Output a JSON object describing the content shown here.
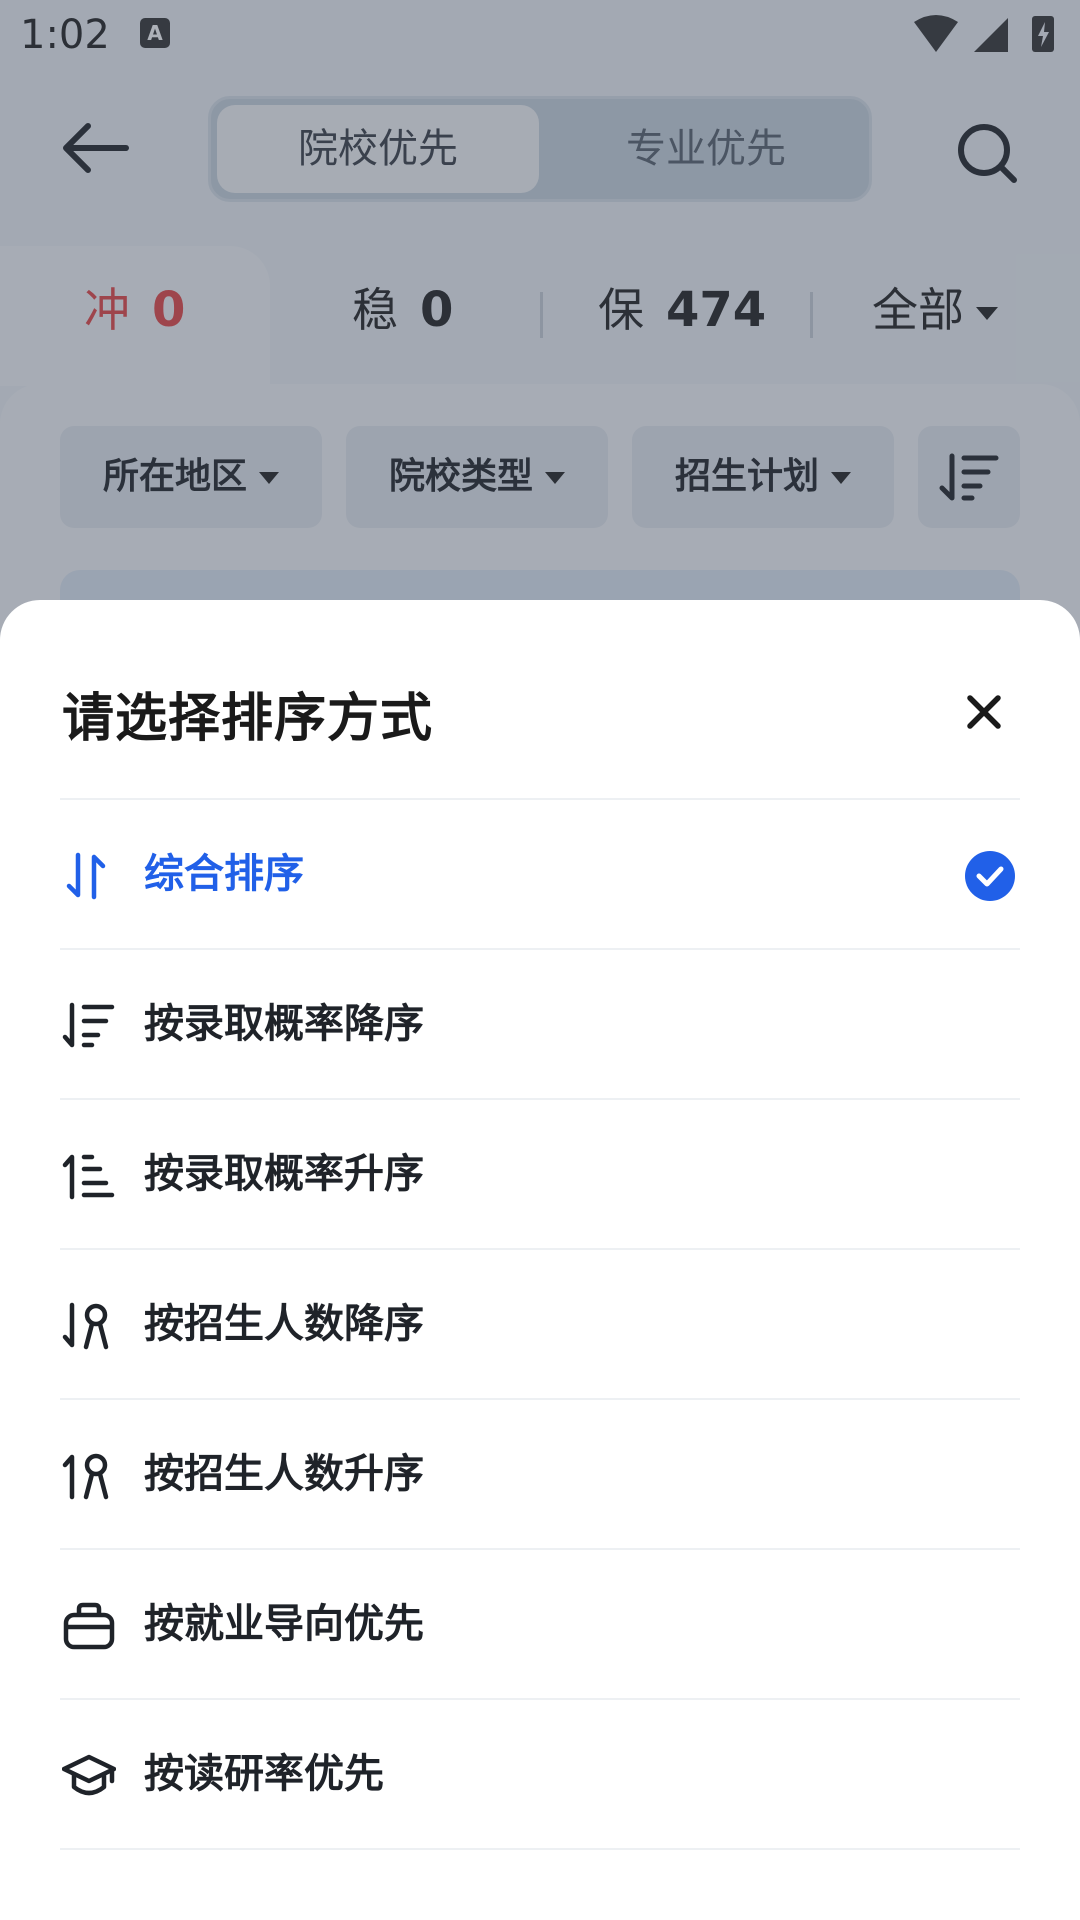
{
  "status_bar": {
    "time": "1:02",
    "notif_glyph": "A"
  },
  "nav": {
    "segments": [
      {
        "label": "院校优先",
        "active": true
      },
      {
        "label": "专业优先",
        "active": false
      }
    ]
  },
  "tabs": [
    {
      "label": "冲",
      "count": "0"
    },
    {
      "label": "稳",
      "count": "0"
    },
    {
      "label": "保",
      "count": "474"
    },
    {
      "label": "全部"
    }
  ],
  "filters": [
    {
      "label": "所在地区"
    },
    {
      "label": "院校类型"
    },
    {
      "label": "招生计划"
    }
  ],
  "sheet": {
    "title": "请选择排序方式",
    "options": [
      {
        "label": "综合排序",
        "icon": "sort-arrows-icon",
        "selected": true
      },
      {
        "label": "按录取概率降序",
        "icon": "sort-descending-icon",
        "selected": false
      },
      {
        "label": "按录取概率升序",
        "icon": "sort-ascending-icon",
        "selected": false
      },
      {
        "label": "按招生人数降序",
        "icon": "people-descending-icon",
        "selected": false
      },
      {
        "label": "按招生人数升序",
        "icon": "people-ascending-icon",
        "selected": false
      },
      {
        "label": "按就业导向优先",
        "icon": "briefcase-icon",
        "selected": false
      },
      {
        "label": "按读研率优先",
        "icon": "graduation-cap-icon",
        "selected": false
      }
    ]
  },
  "colors": {
    "accent": "#2160e8",
    "chong_red": "#e54545",
    "overlay": "#3c4655"
  }
}
